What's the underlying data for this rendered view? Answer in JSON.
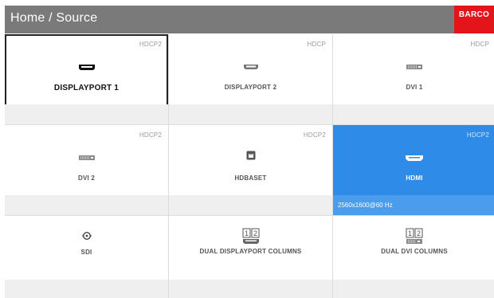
{
  "header": {
    "title": "Home / Source",
    "logo": "BARCO"
  },
  "colors": {
    "header_bg": "#7a7a7a",
    "logo_bg": "#e4141b",
    "active_bg": "#2e8ce8",
    "active_footer": "#4a9ced",
    "tile_footer": "#efefef"
  },
  "tiles": [
    {
      "label": "DISPLAYPORT 1",
      "hdcp": "HDCP2",
      "icon": "displayport-icon",
      "status": "",
      "selected": true,
      "active": false
    },
    {
      "label": "DISPLAYPORT 2",
      "hdcp": "HDCP",
      "icon": "displayport-icon",
      "status": "",
      "selected": false,
      "active": false
    },
    {
      "label": "DVI 1",
      "hdcp": "HDCP",
      "icon": "dvi-icon",
      "status": "",
      "selected": false,
      "active": false
    },
    {
      "label": "DVI 2",
      "hdcp": "HDCP2",
      "icon": "dvi-icon",
      "status": "",
      "selected": false,
      "active": false
    },
    {
      "label": "HDBASET",
      "hdcp": "HDCP2",
      "icon": "hdbaset-icon",
      "status": "",
      "selected": false,
      "active": false
    },
    {
      "label": "HDMI",
      "hdcp": "HDCP2",
      "icon": "hdmi-icon",
      "status": "2560x1600@60 Hz",
      "selected": false,
      "active": true
    },
    {
      "label": "SDI",
      "hdcp": "",
      "icon": "sdi-icon",
      "status": "",
      "selected": false,
      "active": false
    },
    {
      "label": "DUAL DISPLAYPORT COLUMNS",
      "hdcp": "",
      "icon": "dual-displayport-icon",
      "status": "",
      "selected": false,
      "active": false
    },
    {
      "label": "DUAL DVI COLUMNS",
      "hdcp": "",
      "icon": "dual-dvi-icon",
      "status": "",
      "selected": false,
      "active": false
    }
  ],
  "dual_numbers": [
    "1",
    "2"
  ]
}
